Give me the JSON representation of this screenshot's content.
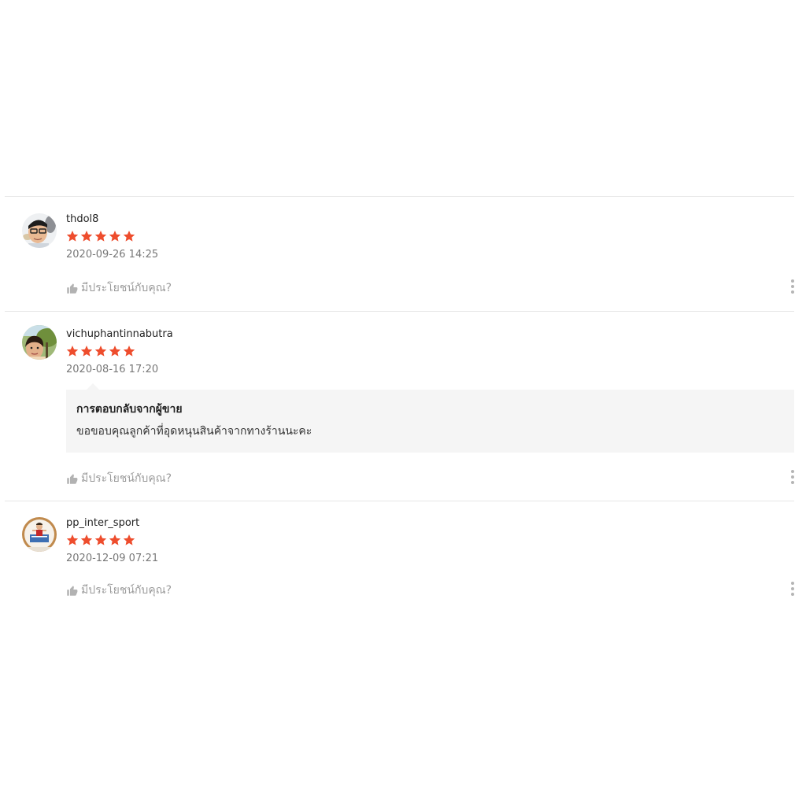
{
  "reviews": [
    {
      "username": "thdol8",
      "rating": 5,
      "date": "2020-09-26 14:25",
      "helpful_label": "มีประโยชน์กับคุณ?",
      "seller_reply": null
    },
    {
      "username": "vichuphantinnabutra",
      "rating": 5,
      "date": "2020-08-16 17:20",
      "helpful_label": "มีประโยชน์กับคุณ?",
      "seller_reply": {
        "title": "การตอบกลับจากผู้ขาย",
        "text": "ขอขอบคุณลูกค้าที่อุดหนุนสินค้าจากทางร้านนะคะ"
      }
    },
    {
      "username": "pp_inter_sport",
      "rating": 5,
      "date": "2020-12-09 07:21",
      "helpful_label": "มีประโยชน์กับคุณ?",
      "seller_reply": null
    }
  ],
  "colors": {
    "star": "#ee4d2d",
    "divider": "#e6e6e6",
    "reply_bg": "#f5f5f5"
  },
  "icons": {
    "star": "star-icon",
    "like": "thumbs-up-icon",
    "more": "more-vertical-icon"
  }
}
